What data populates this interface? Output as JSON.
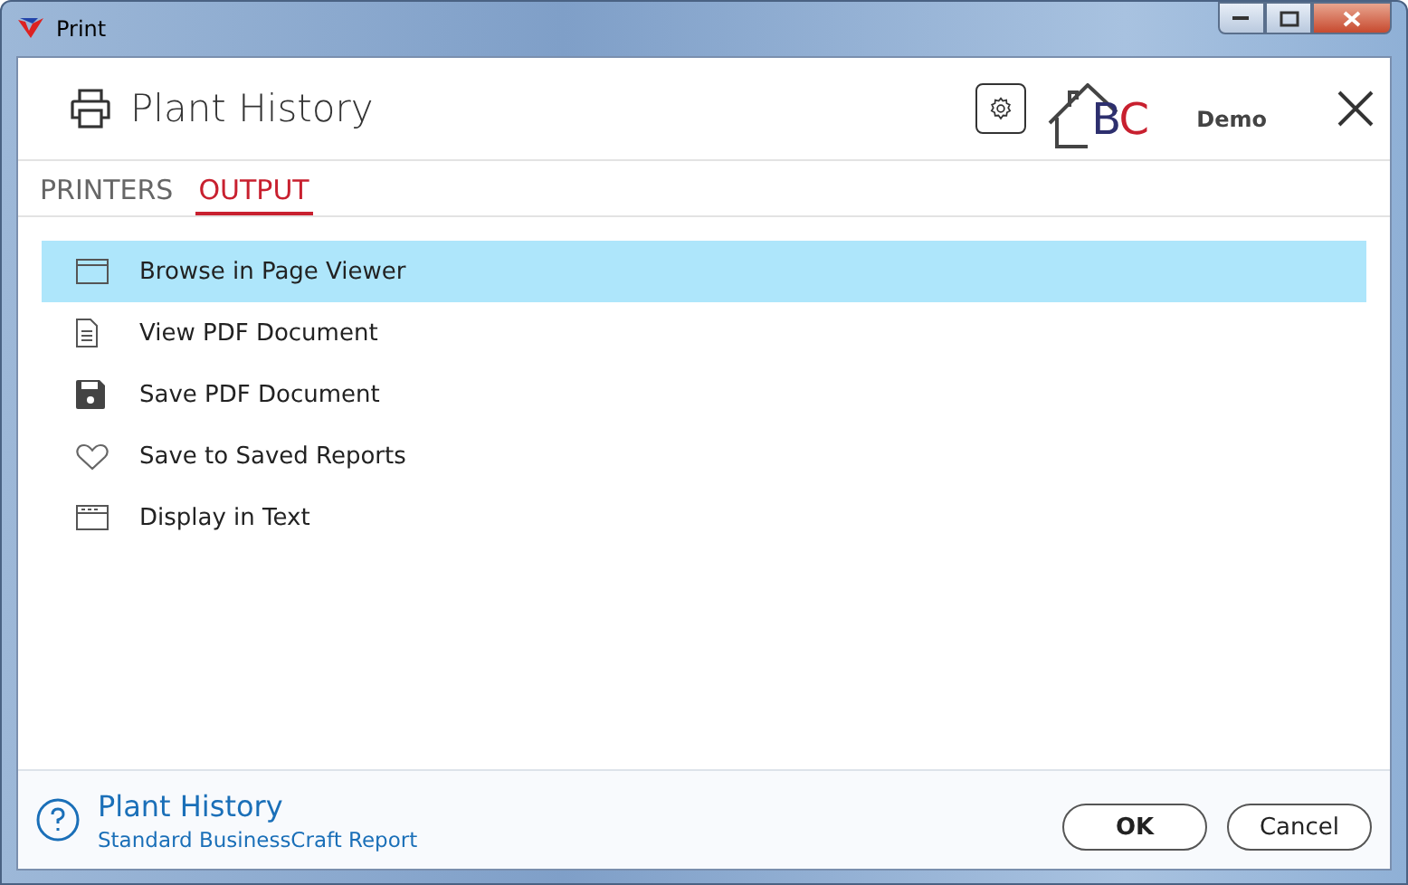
{
  "window": {
    "title": "Print"
  },
  "header": {
    "title": "Plant History",
    "logo": {
      "initials": "BC",
      "caption": "Demo"
    }
  },
  "tabs": [
    {
      "label": "PRINTERS",
      "selected": false
    },
    {
      "label": "OUTPUT",
      "selected": true
    }
  ],
  "options": [
    {
      "label": "Browse in Page Viewer",
      "kind": "window",
      "selected": true
    },
    {
      "label": "View PDF Document",
      "kind": "document",
      "selected": false
    },
    {
      "label": "Save PDF Document",
      "kind": "save",
      "selected": false
    },
    {
      "label": "Save to Saved Reports",
      "kind": "heart",
      "selected": false
    },
    {
      "label": "Display in Text",
      "kind": "text-window",
      "selected": false
    }
  ],
  "footer": {
    "title": "Plant History",
    "subtitle": "Standard BusinessCraft Report"
  },
  "buttons": [
    "OK",
    "Cancel"
  ]
}
